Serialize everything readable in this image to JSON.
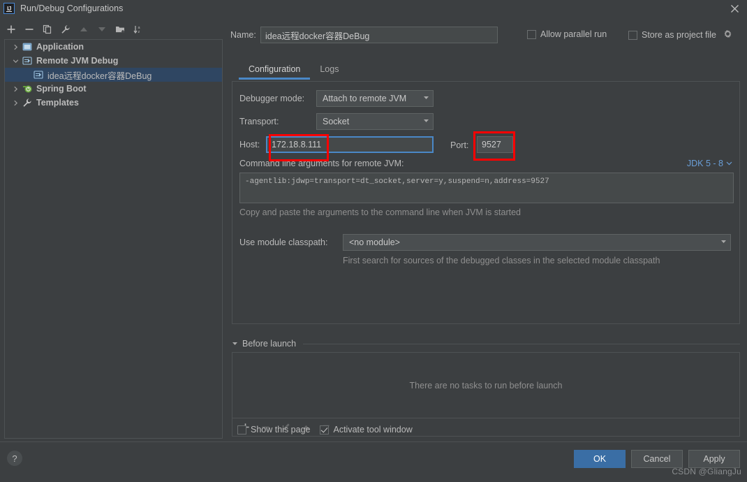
{
  "window": {
    "title": "Run/Debug Configurations",
    "logo_icon": "intellij-idea-logo",
    "close_icon": "close-icon"
  },
  "tree_toolbar": [
    {
      "name": "add-configuration-button",
      "icon": "plus-icon",
      "disabled": false
    },
    {
      "name": "remove-configuration-button",
      "icon": "minus-icon",
      "disabled": false
    },
    {
      "name": "copy-configuration-button",
      "icon": "copy-icon",
      "disabled": false
    },
    {
      "name": "edit-templates-button",
      "icon": "wrench-icon",
      "disabled": false
    },
    {
      "name": "move-up-button",
      "icon": "arrow-up-icon",
      "disabled": true
    },
    {
      "name": "move-down-button",
      "icon": "arrow-down-icon",
      "disabled": true
    },
    {
      "name": "new-folder-button",
      "icon": "folder-add-icon",
      "disabled": false
    },
    {
      "name": "sort-configurations-button",
      "icon": "sort-az-icon",
      "disabled": false
    }
  ],
  "tree": [
    {
      "label": "Application",
      "icon": "application-icon",
      "expanded": false,
      "level": 0,
      "selected": false,
      "group": true
    },
    {
      "label": "Remote JVM Debug",
      "icon": "remote-jvm-debug-icon",
      "expanded": true,
      "level": 0,
      "selected": false,
      "group": true
    },
    {
      "label": "idea远程docker容器DeBug",
      "icon": "remote-jvm-debug-icon",
      "expanded": null,
      "level": 1,
      "selected": true,
      "group": false
    },
    {
      "label": "Spring Boot",
      "icon": "spring-boot-icon",
      "expanded": false,
      "level": 0,
      "selected": false,
      "group": true
    },
    {
      "label": "Templates",
      "icon": "wrench-icon",
      "expanded": false,
      "level": 0,
      "selected": false,
      "group": true
    }
  ],
  "form": {
    "name_label": "Name:",
    "name_value": "idea远程docker容器DeBug",
    "allow_parallel_run": {
      "label": "Allow parallel run",
      "checked": false
    },
    "store_as_project_file": {
      "label": "Store as project file",
      "checked": false,
      "gear_icon": "gear-icon"
    }
  },
  "tabs": [
    {
      "label": "Configuration",
      "active": true
    },
    {
      "label": "Logs",
      "active": false
    }
  ],
  "configuration": {
    "debugger_mode_label": "Debugger mode:",
    "debugger_mode_value": "Attach to remote JVM",
    "transport_label": "Transport:",
    "transport_value": "Socket",
    "host_label": "Host:",
    "host_value": "172.18.8.111",
    "port_label": "Port:",
    "port_value": "9527",
    "cli_label": "Command line arguments for remote JVM:",
    "jdk_badge": "JDK 5 - 8",
    "cli_value": "-agentlib:jdwp=transport=dt_socket,server=y,suspend=n,address=9527",
    "cli_hint": "Copy and paste the arguments to the command line when JVM is started",
    "module_classpath_label": "Use module classpath:",
    "module_classpath_value": "<no module>",
    "module_hint": "First search for sources of the debugged classes in the selected module classpath"
  },
  "before_launch": {
    "title": "Before launch",
    "empty_message": "There are no tasks to run before launch",
    "toolbar": [
      {
        "name": "add-task-button",
        "icon": "plus-icon",
        "disabled": false
      },
      {
        "name": "remove-task-button",
        "icon": "minus-icon",
        "disabled": true
      },
      {
        "name": "edit-task-button",
        "icon": "pencil-icon",
        "disabled": true
      },
      {
        "name": "task-move-up-button",
        "icon": "arrow-up-icon",
        "disabled": true
      },
      {
        "name": "task-move-down-button",
        "icon": "arrow-down-icon",
        "disabled": true
      }
    ]
  },
  "bottom": {
    "show_this_page": {
      "label": "Show this page",
      "checked": false
    },
    "activate_tool_window": {
      "label": "Activate tool window",
      "checked": true
    },
    "help_label": "?",
    "ok_label": "OK",
    "cancel_label": "Cancel",
    "apply_label": "Apply"
  },
  "watermark": "CSDN @GliangJu",
  "colors": {
    "background": "#3c3f41",
    "panel_border": "#4e5254",
    "selection": "#2f4662",
    "accent_blue": "#4a88c7",
    "primary_button": "#3a6ea5",
    "link_blue": "#6a9fd8",
    "annotation_red": "#ff0000",
    "text": "#bbbbbb",
    "muted_text": "#8f8f8f"
  }
}
